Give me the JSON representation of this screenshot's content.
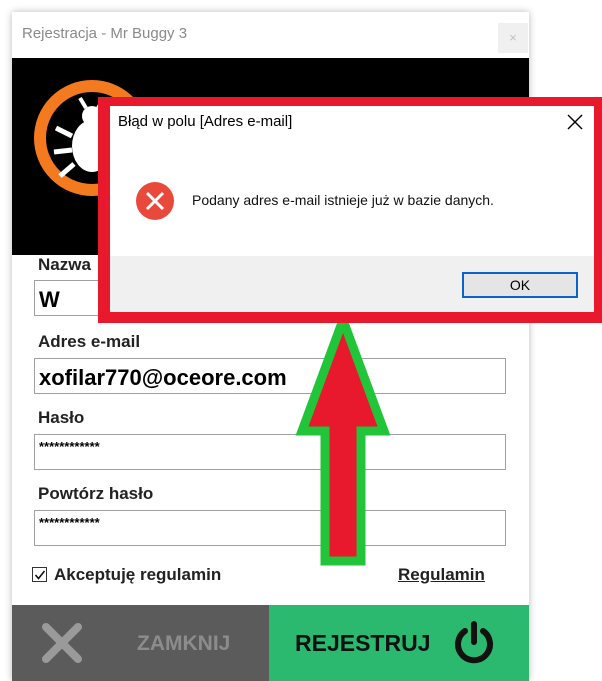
{
  "window": {
    "title": "Rejestracja - Mr Buggy 3",
    "close_glyph": "×"
  },
  "form": {
    "username_label": "Nazwa",
    "username_value": "W",
    "email_label": "Adres e-mail",
    "email_value": "xofilar770@oceore.com",
    "password_label": "Hasło",
    "password_value": "************",
    "repeat_password_label": "Powtórz hasło",
    "repeat_password_value": "************",
    "accept_label": "Akceptuję regulamin",
    "accept_checked": true,
    "terms_link": "Regulamin"
  },
  "footer": {
    "close_label": "ZAMKNIJ",
    "register_label": "REJESTRUJ",
    "close_color": "#5b5b5b",
    "register_color": "#2bb86f"
  },
  "dialog": {
    "title": "Błąd w polu [Adres e-mail]",
    "message": "Podany adres e-mail istnieje już w bazie danych.",
    "ok_label": "OK",
    "icon": "error-icon",
    "highlight_color": "#e8192c"
  },
  "annotation": {
    "arrow_fill": "#e8192c",
    "arrow_outline": "#22c43a"
  },
  "icons": {
    "logo": "bug-logo-icon",
    "close": "x-icon",
    "register": "power-icon"
  }
}
